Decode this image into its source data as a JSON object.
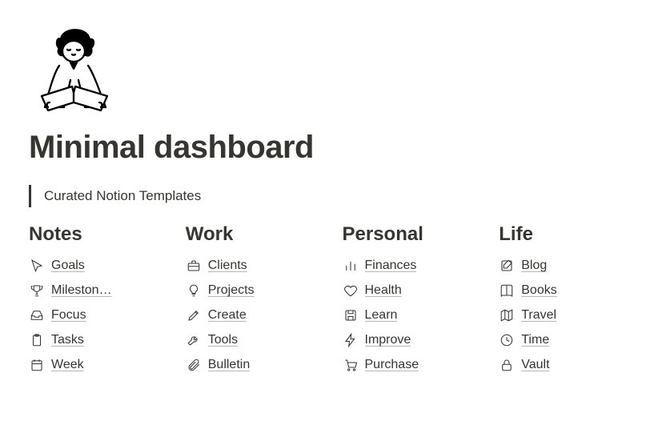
{
  "page": {
    "title": "Minimal dashboard",
    "callout": "Curated Notion Templates"
  },
  "columns": [
    {
      "header": "Notes",
      "items": [
        {
          "icon": "cursor-icon",
          "label": "Goals"
        },
        {
          "icon": "trophy-icon",
          "label": "Mileston…"
        },
        {
          "icon": "drawer-icon",
          "label": "Focus"
        },
        {
          "icon": "clipboard-icon",
          "label": "Tasks"
        },
        {
          "icon": "calendar-icon",
          "label": "Week"
        }
      ]
    },
    {
      "header": "Work",
      "items": [
        {
          "icon": "briefcase-icon",
          "label": "Clients"
        },
        {
          "icon": "lightbulb-icon",
          "label": "Projects"
        },
        {
          "icon": "pencil-icon",
          "label": "Create"
        },
        {
          "icon": "wrench-icon",
          "label": "Tools"
        },
        {
          "icon": "paperclip-icon",
          "label": "Bulletin"
        }
      ]
    },
    {
      "header": "Personal",
      "items": [
        {
          "icon": "bar-chart-icon",
          "label": "Finances"
        },
        {
          "icon": "heart-icon",
          "label": "Health"
        },
        {
          "icon": "save-icon",
          "label": "Learn"
        },
        {
          "icon": "bolt-icon",
          "label": "Improve"
        },
        {
          "icon": "cart-icon",
          "label": "Purchase"
        }
      ]
    },
    {
      "header": "Life",
      "items": [
        {
          "icon": "edit-square-icon",
          "label": "Blog"
        },
        {
          "icon": "book-icon",
          "label": "Books"
        },
        {
          "icon": "map-icon",
          "label": "Travel"
        },
        {
          "icon": "clock-icon",
          "label": "Time"
        },
        {
          "icon": "lock-icon",
          "label": "Vault"
        }
      ]
    }
  ]
}
